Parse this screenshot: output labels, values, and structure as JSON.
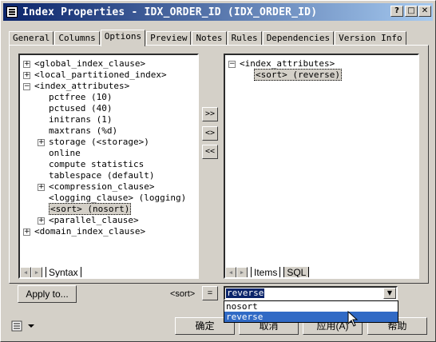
{
  "window": {
    "title": "Index Properties - IDX_ORDER_ID (IDX_ORDER_ID)"
  },
  "titlebar_buttons": {
    "help": "?",
    "maximize": "□",
    "close": "✕"
  },
  "tabs": [
    {
      "label": "General"
    },
    {
      "label": "Columns"
    },
    {
      "label": "Options"
    },
    {
      "label": "Preview"
    },
    {
      "label": "Notes"
    },
    {
      "label": "Rules"
    },
    {
      "label": "Dependencies"
    },
    {
      "label": "Version Info"
    }
  ],
  "active_tab": "Options",
  "left_tree": [
    {
      "label": "<global_index_clause>",
      "expander": "+"
    },
    {
      "label": "<local_partitioned_index>",
      "expander": "+"
    },
    {
      "label": "<index_attributes>",
      "expander": "-"
    },
    {
      "label": "pctfree (10)",
      "expander": ""
    },
    {
      "label": "pctused (40)",
      "expander": ""
    },
    {
      "label": "initrans (1)",
      "expander": ""
    },
    {
      "label": "maxtrans (%d)",
      "expander": ""
    },
    {
      "label": "storage (<storage>)",
      "expander": "+"
    },
    {
      "label": "online",
      "expander": ""
    },
    {
      "label": "compute statistics",
      "expander": ""
    },
    {
      "label": "tablespace (default)",
      "expander": ""
    },
    {
      "label": "<compression_clause>",
      "expander": "+"
    },
    {
      "label": "<logging_clause> (logging)",
      "expander": ""
    },
    {
      "label": "<sort> (nosort)",
      "expander": ""
    },
    {
      "label": "<parallel_clause>",
      "expander": "+"
    },
    {
      "label": "<domain_index_clause>",
      "expander": "+"
    }
  ],
  "right_tree": [
    {
      "label": "<index_attributes>",
      "expander": "-"
    },
    {
      "label": "<sort> (reverse)",
      "expander": ""
    }
  ],
  "mid_buttons": {
    "add": ">>",
    "replace": "<>",
    "remove": "<<"
  },
  "left_bottom_tabs": [
    {
      "label": "Syntax"
    }
  ],
  "right_bottom_tabs": [
    {
      "label": "Items"
    },
    {
      "label": "SQL"
    }
  ],
  "apply_to_label": "Apply to...",
  "property_name": "<sort>",
  "equals": "=",
  "dropdown": {
    "value": "reverse",
    "options": [
      "nosort",
      "reverse"
    ],
    "highlighted": "reverse"
  },
  "footer": {
    "ok": "确定",
    "cancel": "取消",
    "apply": "应用(A)",
    "help": "帮助"
  }
}
